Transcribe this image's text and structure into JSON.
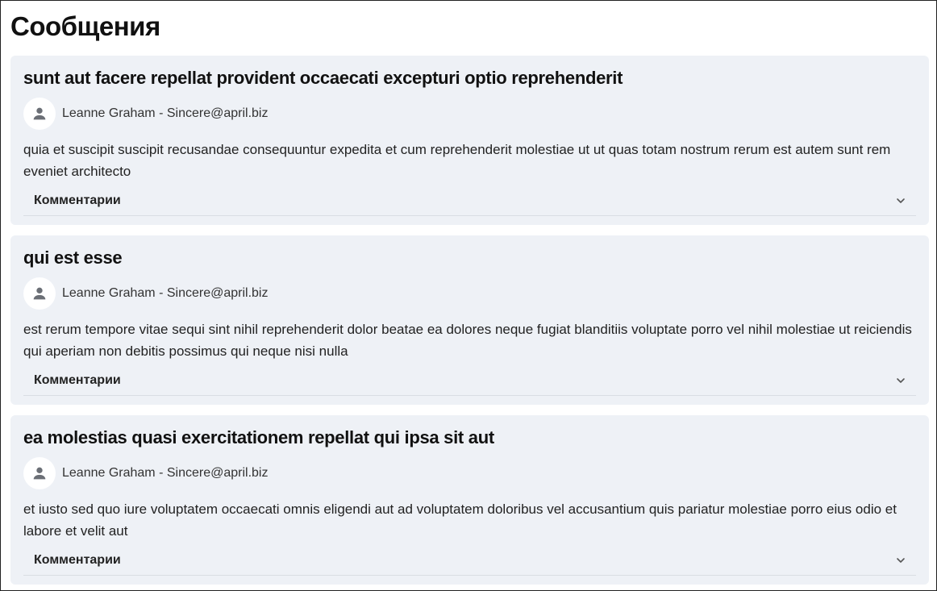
{
  "page": {
    "title": "Сообщения"
  },
  "posts": [
    {
      "title": "sunt aut facere repellat provident occaecati excepturi optio reprehenderit",
      "author": "Leanne Graham - Sincere@april.biz",
      "body": "quia et suscipit suscipit recusandae consequuntur expedita et cum reprehenderit molestiae ut ut quas totam nostrum rerum est autem sunt rem eveniet architecto",
      "comments_label": "Комментарии"
    },
    {
      "title": "qui est esse",
      "author": "Leanne Graham - Sincere@april.biz",
      "body": "est rerum tempore vitae sequi sint nihil reprehenderit dolor beatae ea dolores neque fugiat blanditiis voluptate porro vel nihil molestiae ut reiciendis qui aperiam non debitis possimus qui neque nisi nulla",
      "comments_label": "Комментарии"
    },
    {
      "title": "ea molestias quasi exercitationem repellat qui ipsa sit aut",
      "author": "Leanne Graham - Sincere@april.biz",
      "body": "et iusto sed quo iure voluptatem occaecati omnis eligendi aut ad voluptatem doloribus vel accusantium quis pariatur molestiae porro eius odio et labore et velit aut",
      "comments_label": "Комментарии"
    }
  ],
  "icons": {
    "avatar": "person-icon",
    "expand": "chevron-down-icon"
  },
  "colors": {
    "card_background": "#eef1f6",
    "avatar_background": "#ffffff",
    "icon": "#6b6f76"
  }
}
